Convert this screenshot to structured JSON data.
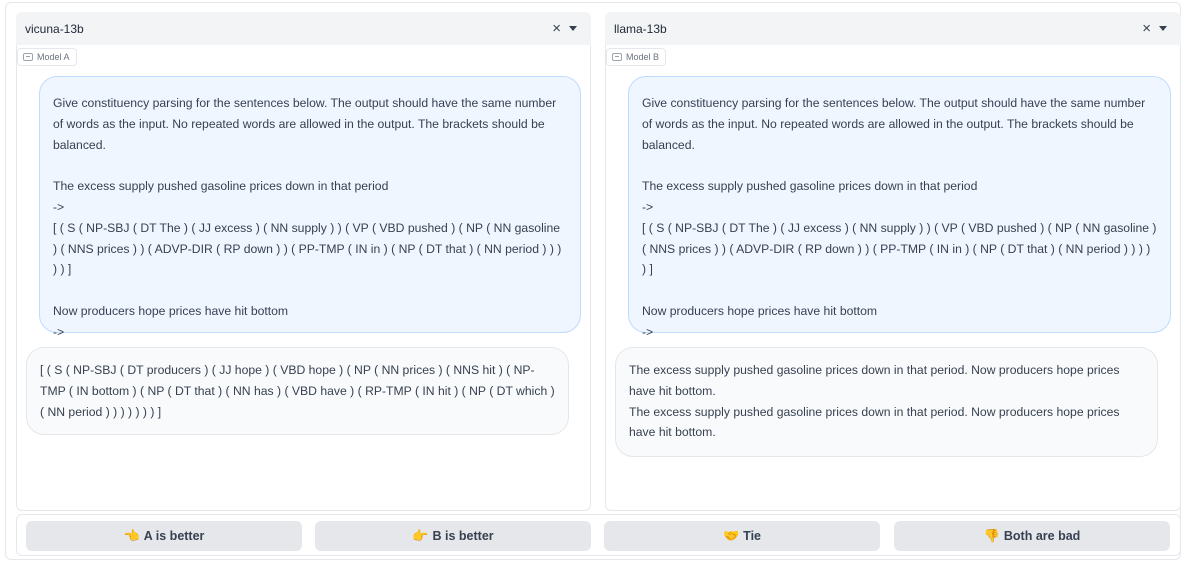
{
  "panels": [
    {
      "model_name": "vicuna-13b",
      "clear_glyph": "×",
      "tag_label": "Model A",
      "user_message": "Give constituency parsing for the sentences below. The output should have the same number of words as the input. No repeated words are allowed in the output. The brackets should be balanced.\n\nThe excess supply pushed gasoline prices down in that period\n->\n[ ( S ( NP-SBJ ( DT The ) ( JJ excess ) ( NN supply ) ) ( VP ( VBD pushed ) ( NP ( NN gasoline ) ( NNS prices ) ) ( ADVP-DIR ( RP down ) ) ( PP-TMP ( IN in ) ( NP ( DT that ) ( NN period ) ) ) ) ) ]\n\nNow producers hope prices have hit bottom\n->",
      "bot_message": "[ ( S ( NP-SBJ ( DT producers ) ( JJ hope ) ( VBD hope ) ( NP ( NN prices ) ( NNS hit ) ( NP-TMP ( IN bottom ) ( NP ( DT that ) ( NN has ) ( VBD have ) ( RP-TMP ( IN hit ) ( NP ( DT which ) ( NN period ) ) ) ) ) ) ) ]"
    },
    {
      "model_name": "llama-13b",
      "clear_glyph": "×",
      "tag_label": "Model B",
      "user_message": "Give constituency parsing for the sentences below. The output should have the same number of words as the input. No repeated words are allowed in the output. The brackets should be balanced.\n\nThe excess supply pushed gasoline prices down in that period\n->\n[ ( S ( NP-SBJ ( DT The ) ( JJ excess ) ( NN supply ) ) ( VP ( VBD pushed ) ( NP ( NN gasoline ) ( NNS prices ) ) ( ADVP-DIR ( RP down ) ) ( PP-TMP ( IN in ) ( NP ( DT that ) ( NN period ) ) ) ) ) ]\n\nNow producers hope prices have hit bottom\n->",
      "bot_message": "The excess supply pushed gasoline prices down in that period. Now producers hope prices have hit bottom.\nThe excess supply pushed gasoline prices down in that period. Now producers hope prices have hit bottom."
    }
  ],
  "vote_buttons": [
    {
      "emoji": "👈",
      "label": "A is better"
    },
    {
      "emoji": "👉",
      "label": "B is better"
    },
    {
      "emoji": "🤝",
      "label": "Tie"
    },
    {
      "emoji": "👎",
      "label": "Both are bad"
    }
  ],
  "colors": {
    "user_bubble_bg": "#eff6ff",
    "user_bubble_border": "#bfdbfe",
    "bot_bubble_bg": "#f9fafb",
    "button_bg": "#e5e7eb"
  }
}
